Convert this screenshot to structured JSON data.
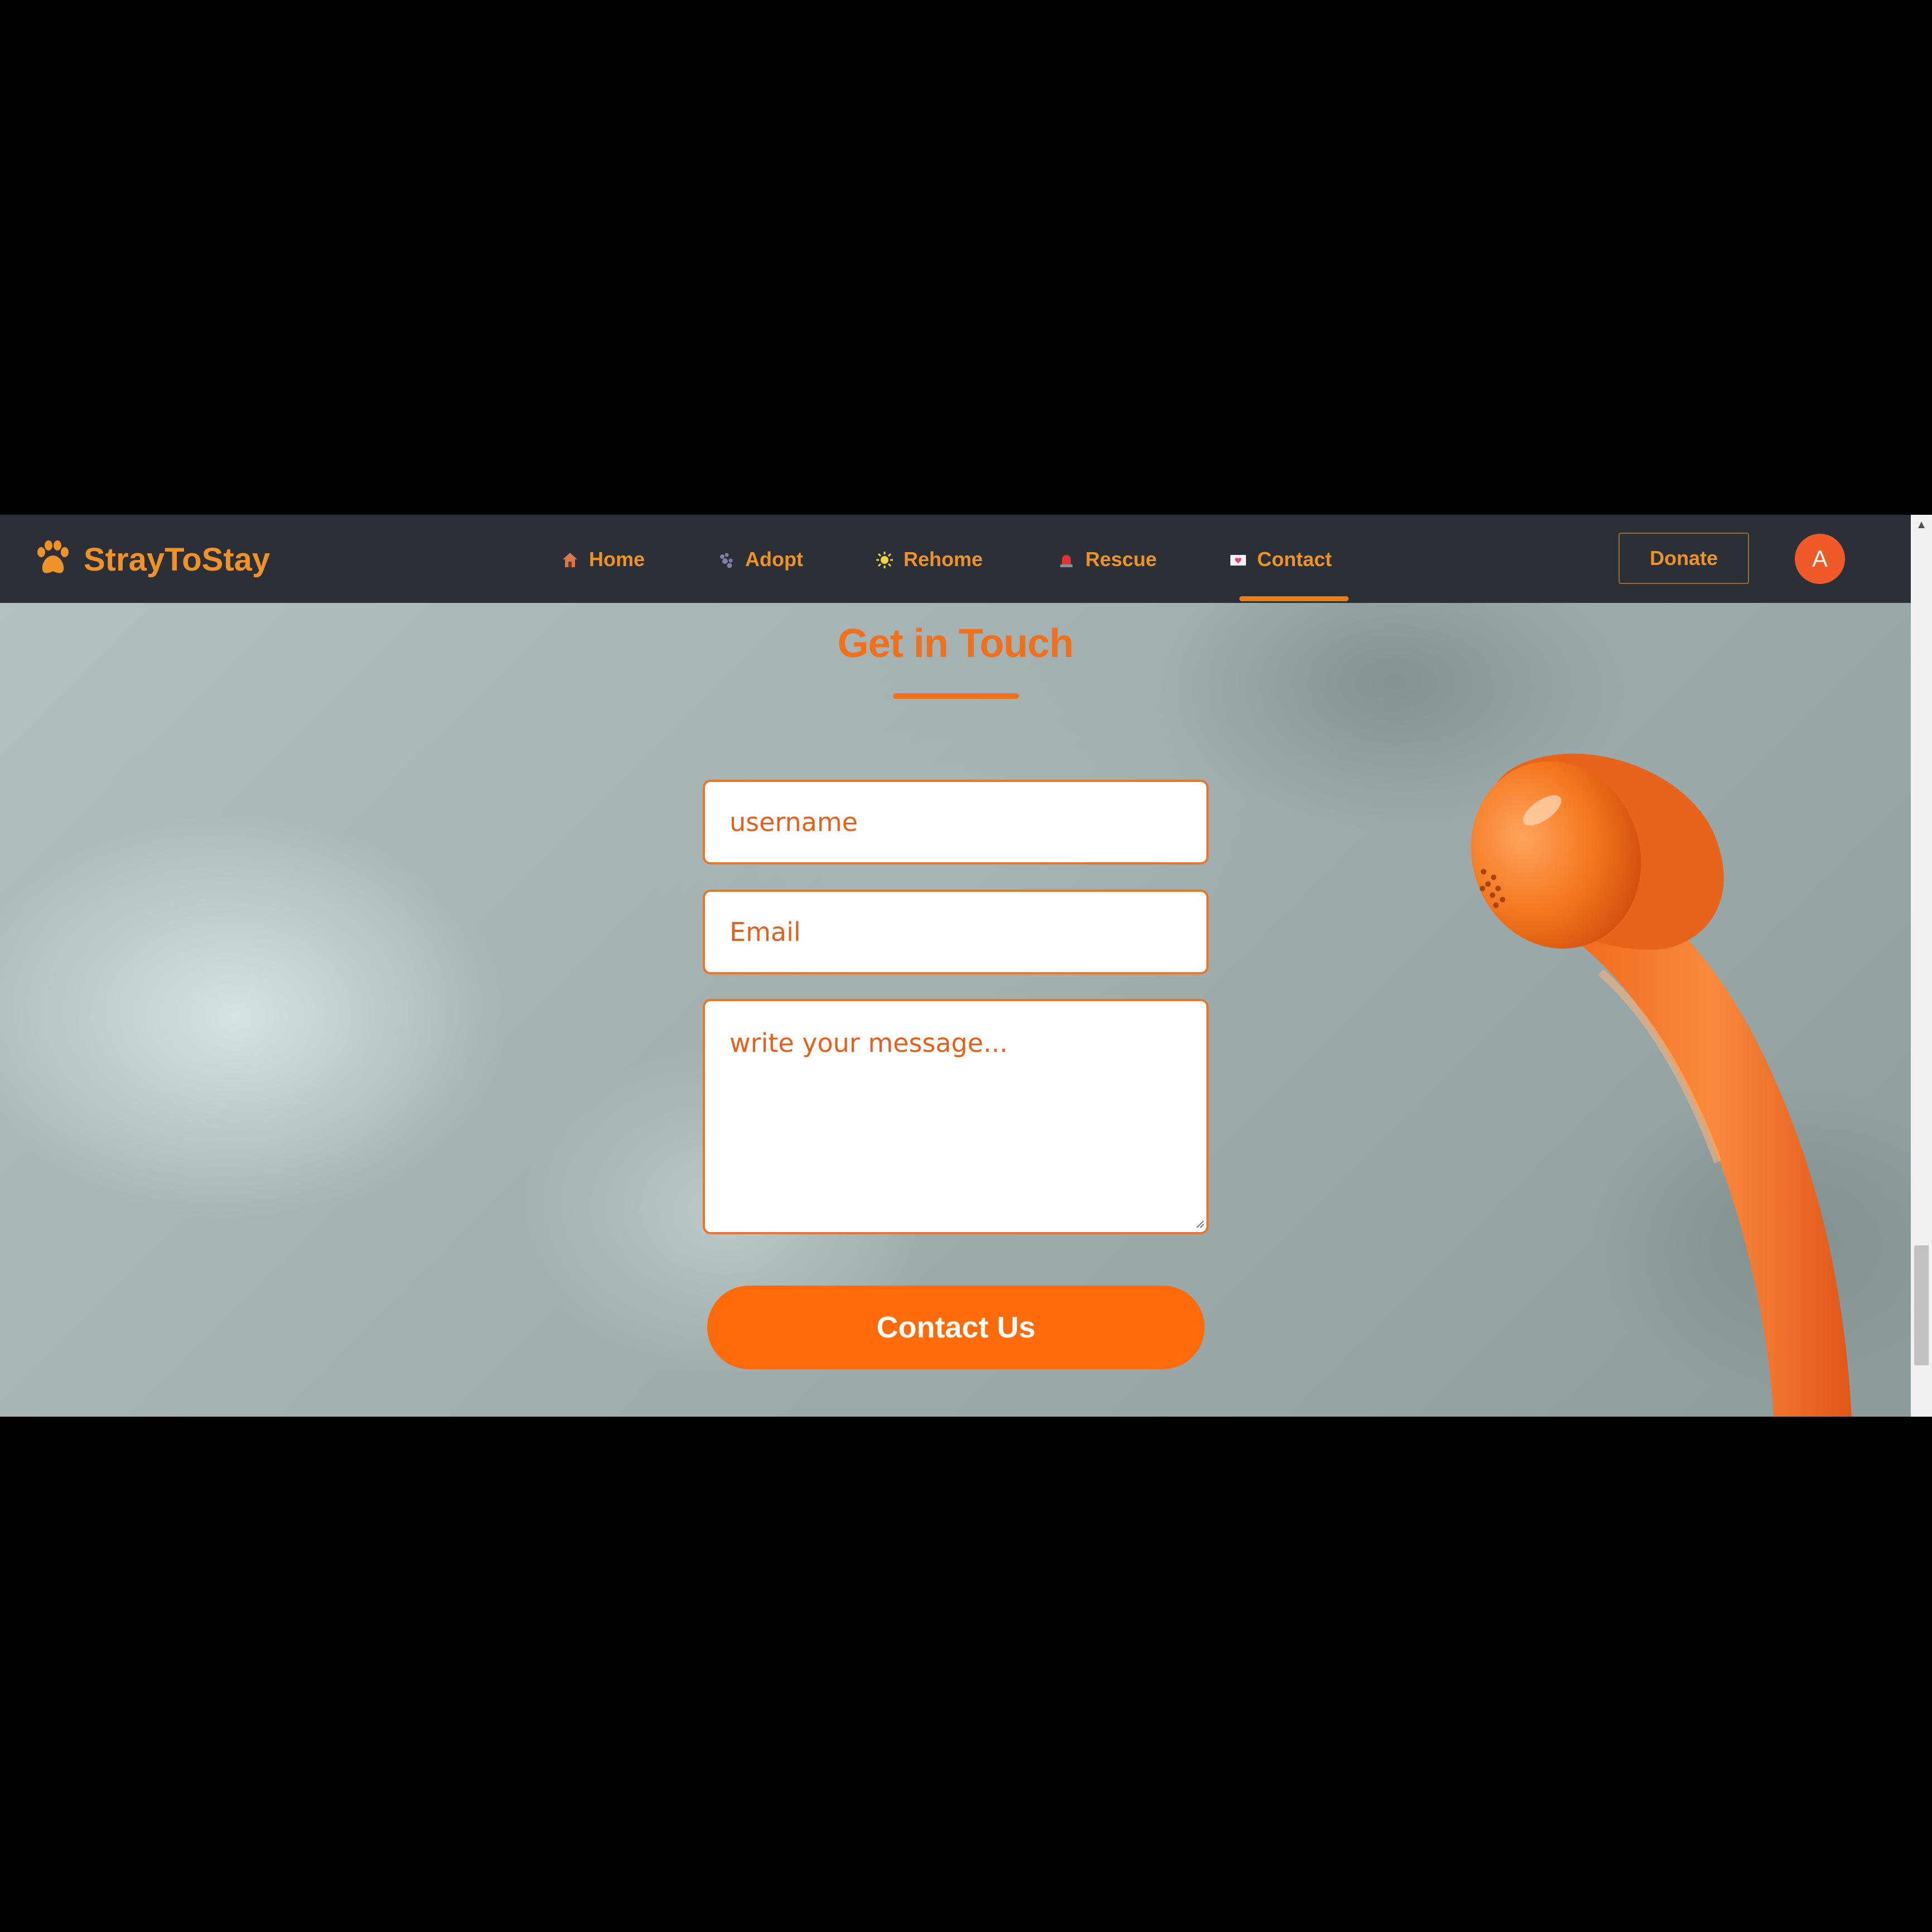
{
  "brand": {
    "name": "StrayToStay",
    "icon": "paw-icon"
  },
  "nav": {
    "items": [
      {
        "label": "Home",
        "icon": "house-icon",
        "active": false
      },
      {
        "label": "Adopt",
        "icon": "paws-icon",
        "active": false
      },
      {
        "label": "Rehome",
        "icon": "sun-icon",
        "active": false
      },
      {
        "label": "Rescue",
        "icon": "siren-icon",
        "active": false
      },
      {
        "label": "Contact",
        "icon": "love-letter-icon",
        "active": true
      }
    ],
    "donate_label": "Donate",
    "avatar_initial": "A"
  },
  "contact": {
    "title": "Get in Touch",
    "username_placeholder": "username",
    "email_placeholder": "Email",
    "message_placeholder": "write your message...",
    "submit_label": "Contact Us"
  },
  "colors": {
    "navbar_bg": "#2b2f38",
    "accent_orange": "#f26f1c",
    "nav_text": "#f0922a",
    "button_orange": "#ff6b0a",
    "avatar_bg": "#f05a28"
  }
}
